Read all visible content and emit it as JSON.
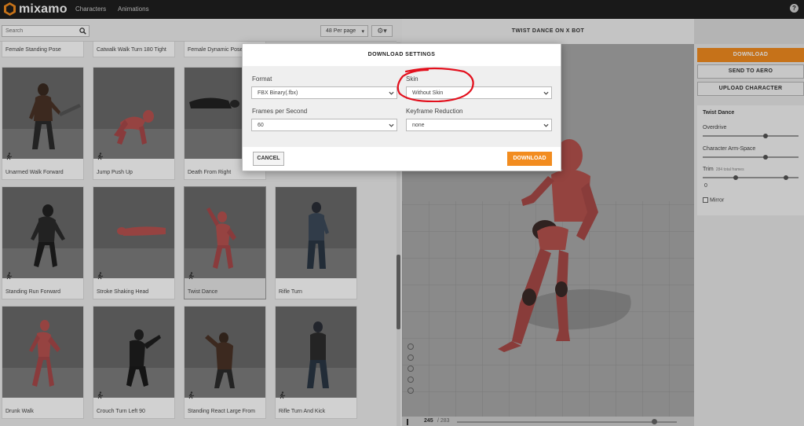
{
  "app": {
    "brand": "mixamo",
    "nav": [
      "Characters",
      "Animations"
    ],
    "help_icon": "help-circle-icon",
    "logo_icon": "mixamo-logo-icon"
  },
  "toolbar": {
    "search_placeholder": "Search",
    "per_page": "48 Per page",
    "gear_icon": "gear-icon"
  },
  "top_row_labels": [
    "Female Standing Pose",
    "Catwalk Walk Turn 180 Tight",
    "Female Dynamic Pose"
  ],
  "tiles": [
    {
      "label": "Unarmed Walk Forward"
    },
    {
      "label": "Jump Push Up"
    },
    {
      "label": "Death From Right"
    },
    {
      "label": "Standing Run Forward"
    },
    {
      "label": "Stroke Shaking Head"
    },
    {
      "label": "Twist Dance"
    },
    {
      "label": "Rifle Turn"
    },
    {
      "label": "Drunk Walk"
    },
    {
      "label": "Crouch Turn Left 90"
    },
    {
      "label": "Standing React Large From"
    },
    {
      "label": "Rifle Turn And Kick"
    }
  ],
  "viewer": {
    "title": "TWIST DANCE ON X BOT",
    "frame_current": "245",
    "frame_total": "/ 283"
  },
  "side": {
    "download": "DOWNLOAD",
    "send_to_aero": "SEND TO AERO",
    "upload_character": "UPLOAD CHARACTER",
    "panel_title": "Twist Dance",
    "overdrive": "Overdrive",
    "arm_space": "Character Arm-Space",
    "trim": "Trim",
    "trim_note": "284 total frames",
    "trim_value": "0",
    "mirror": "Mirror"
  },
  "modal": {
    "title": "DOWNLOAD SETTINGS",
    "format_label": "Format",
    "format_value": "FBX Binary(.fbx)",
    "skin_label": "Skin",
    "skin_value": "Without Skin",
    "fps_label": "Frames per Second",
    "fps_value": "60",
    "keyframe_label": "Keyframe Reduction",
    "keyframe_value": "none",
    "cancel": "CANCEL",
    "download": "DOWNLOAD"
  },
  "colors": {
    "accent": "#f28c1f",
    "annotation": "#e3101d",
    "topbar": "#1f1f1f"
  }
}
